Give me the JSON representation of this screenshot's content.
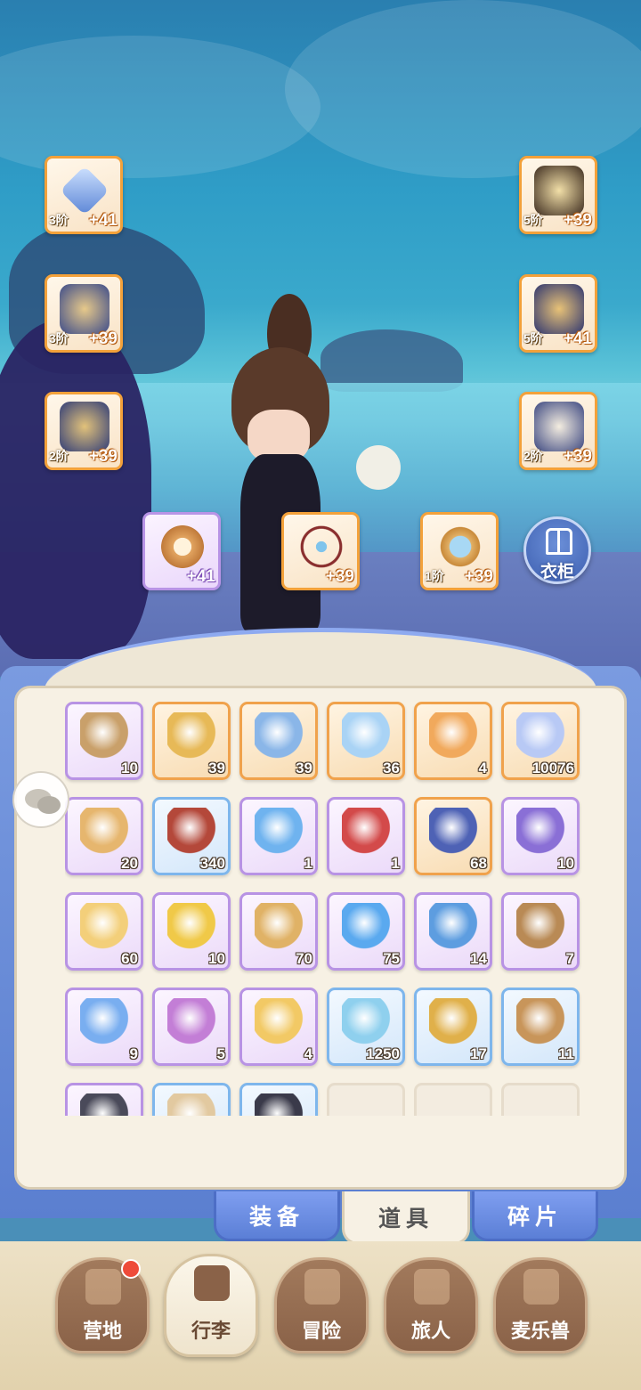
{
  "equipment": {
    "weapon": {
      "tier": "3阶",
      "bonus": "+41",
      "color": "#f3a13a"
    },
    "armor": {
      "tier": "3阶",
      "bonus": "+39",
      "color": "#f3a13a"
    },
    "pants": {
      "tier": "2阶",
      "bonus": "+39",
      "color": "#f3a13a"
    },
    "helmet": {
      "tier": "5阶",
      "bonus": "+39",
      "color": "#f3a13a"
    },
    "gloves": {
      "tier": "5阶",
      "bonus": "+41",
      "color": "#f3a13a"
    },
    "boots": {
      "tier": "2阶",
      "bonus": "+39",
      "color": "#f3a13a"
    },
    "ring": {
      "tier": "",
      "bonus": "+41",
      "color": "#b894e6"
    },
    "necklace": {
      "tier": "",
      "bonus": "+39",
      "color": "#f3a13a"
    },
    "charm": {
      "tier": "1阶",
      "bonus": "+39",
      "color": "#f3a13a"
    }
  },
  "wardrobe": {
    "label": "衣柜",
    "icon": "wardrobe-icon"
  },
  "inventory": {
    "items": [
      {
        "icon": "character-portrait-icon",
        "count": "10",
        "rarity": "purple"
      },
      {
        "icon": "golden-lyre-icon",
        "count": "39",
        "rarity": "orange"
      },
      {
        "icon": "rune-orb-icon",
        "count": "39",
        "rarity": "orange"
      },
      {
        "icon": "ice-crystal-crown-icon",
        "count": "36",
        "rarity": "orange"
      },
      {
        "icon": "summon-card-icon",
        "count": "4",
        "rarity": "orange"
      },
      {
        "icon": "star-crystal-icon",
        "count": "10076",
        "rarity": "orange"
      },
      {
        "icon": "cookie-icon",
        "count": "20",
        "rarity": "purple"
      },
      {
        "icon": "meat-steak-icon",
        "count": "340",
        "rarity": "blue"
      },
      {
        "icon": "blue-potion-icon",
        "count": "1",
        "rarity": "purple"
      },
      {
        "icon": "red-potion-icon",
        "count": "1",
        "rarity": "purple"
      },
      {
        "icon": "eye-tarot-card-icon",
        "count": "68",
        "rarity": "orange"
      },
      {
        "icon": "purple-cat-lens-icon",
        "count": "10",
        "rarity": "purple"
      },
      {
        "icon": "cheese-icon",
        "count": "60",
        "rarity": "purple"
      },
      {
        "icon": "golden-leaf-icon",
        "count": "10",
        "rarity": "purple"
      },
      {
        "icon": "star-biscuit-icon",
        "count": "70",
        "rarity": "purple"
      },
      {
        "icon": "blue-jelly-icon",
        "count": "75",
        "rarity": "purple"
      },
      {
        "icon": "ticket-icon",
        "count": "14",
        "rarity": "purple"
      },
      {
        "icon": "recipe-book-icon",
        "count": "7",
        "rarity": "purple"
      },
      {
        "icon": "blue-flower-icon",
        "count": "9",
        "rarity": "purple"
      },
      {
        "icon": "purple-flower-icon",
        "count": "5",
        "rarity": "purple"
      },
      {
        "icon": "yellow-flower-icon",
        "count": "4",
        "rarity": "purple"
      },
      {
        "icon": "blue-crystal-icon",
        "count": "1250",
        "rarity": "blue"
      },
      {
        "icon": "blue-cat-lens-icon",
        "count": "17",
        "rarity": "blue"
      },
      {
        "icon": "paw-sack-icon",
        "count": "11",
        "rarity": "blue"
      },
      {
        "icon": "dark-ore-icon",
        "count": "",
        "rarity": "purple"
      },
      {
        "icon": "scroll-icon",
        "count": "",
        "rarity": "blue"
      },
      {
        "icon": "dark-stone-icon",
        "count": "",
        "rarity": "blue"
      },
      {
        "icon": "",
        "count": "",
        "rarity": "empty"
      },
      {
        "icon": "",
        "count": "",
        "rarity": "empty"
      },
      {
        "icon": "",
        "count": "",
        "rarity": "empty"
      }
    ]
  },
  "tabs": [
    {
      "label": "装备",
      "active": false
    },
    {
      "label": "道具",
      "active": true
    },
    {
      "label": "碎片",
      "active": false
    }
  ],
  "nav": [
    {
      "label": "营地",
      "icon": "castle-icon",
      "active": false,
      "badge": true
    },
    {
      "label": "行李",
      "icon": "backpack-icon",
      "active": true,
      "badge": false
    },
    {
      "label": "冒险",
      "icon": "crossed-swords-icon",
      "active": false,
      "badge": false
    },
    {
      "label": "旅人",
      "icon": "traveler-portrait-icon",
      "active": false,
      "badge": false
    },
    {
      "label": "麦乐兽",
      "icon": "cat-pet-icon",
      "active": false,
      "badge": false
    }
  ],
  "colors": {
    "orange_rarity": "#f0a24c",
    "purple_rarity": "#b893e4",
    "blue_rarity": "#7eb6ec",
    "panel_bg": "#f7f1e4",
    "frame_blue": "#5b7fd0",
    "nav_brown": "#8a6248",
    "badge_red": "#ee4b3a"
  }
}
